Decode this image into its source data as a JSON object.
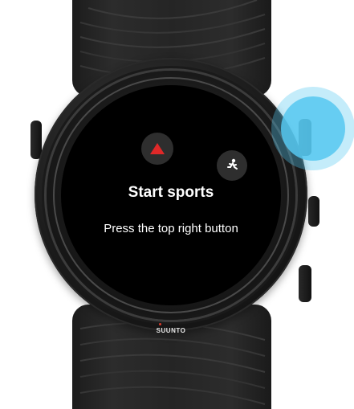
{
  "screen": {
    "title": "Start sports",
    "instruction": "Press the top right button"
  },
  "watch": {
    "brand": "SUUNTO"
  },
  "icons": {
    "up_button": "triangle-up-icon",
    "sport_button": "running-figure-icon",
    "press_indicator": "press-highlight-icon"
  },
  "colors": {
    "screen_background": "#000000",
    "button_background": "#2e2e2e",
    "accent_red": "#e02828",
    "highlight_blue": "#56c8f0",
    "text": "#ffffff"
  }
}
